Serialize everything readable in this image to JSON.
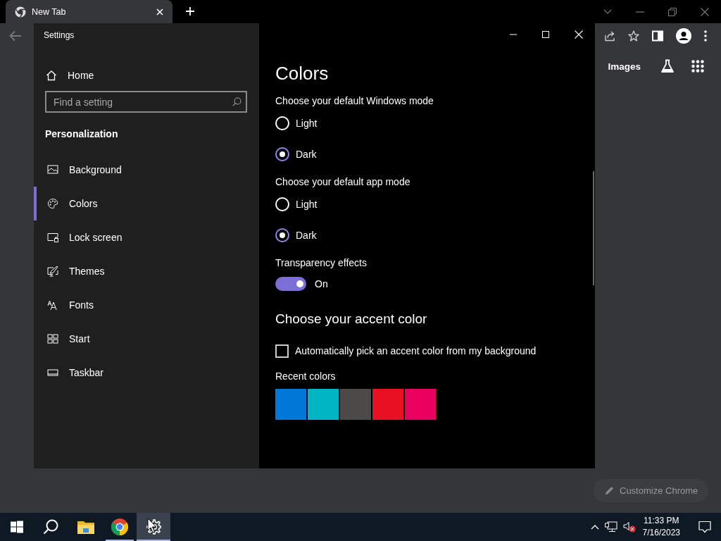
{
  "browser": {
    "tab": {
      "title": "New Tab"
    },
    "links": [
      "Images"
    ],
    "customize_button": "Customize Chrome"
  },
  "settings_window": {
    "title": "Settings",
    "home": "Home",
    "search": {
      "placeholder": "Find a setting"
    },
    "section": "Personalization",
    "nav": [
      {
        "label": "Background",
        "kind": "background",
        "selected": false
      },
      {
        "label": "Colors",
        "kind": "colors",
        "selected": true
      },
      {
        "label": "Lock screen",
        "kind": "lock",
        "selected": false
      },
      {
        "label": "Themes",
        "kind": "themes",
        "selected": false
      },
      {
        "label": "Fonts",
        "kind": "fonts",
        "selected": false
      },
      {
        "label": "Start",
        "kind": "start",
        "selected": false
      },
      {
        "label": "Taskbar",
        "kind": "taskbar",
        "selected": false
      }
    ],
    "page_title": "Colors",
    "groups": [
      {
        "label": "Choose your default Windows mode",
        "options": [
          {
            "label": "Light",
            "selected": false
          },
          {
            "label": "Dark",
            "selected": true
          }
        ]
      },
      {
        "label": "Choose your default app mode",
        "options": [
          {
            "label": "Light",
            "selected": false
          },
          {
            "label": "Dark",
            "selected": true
          }
        ]
      }
    ],
    "transparency": {
      "label": "Transparency effects",
      "on": true,
      "state_text": "On"
    },
    "accent_heading": "Choose your accent color",
    "auto_accent": {
      "label": "Automatically pick an accent color from my background",
      "checked": false
    },
    "recent_label": "Recent colors",
    "recent_colors": [
      {
        "color": "#0078d7"
      },
      {
        "color": "#00b7c3"
      },
      {
        "color": "#4c4a48"
      },
      {
        "color": "#e81123"
      },
      {
        "color": "#ea005e"
      }
    ]
  },
  "taskbar": {
    "apps": [
      {
        "kind": "start",
        "running": false,
        "selected": false
      },
      {
        "kind": "search",
        "running": false,
        "selected": false
      },
      {
        "kind": "files",
        "running": false,
        "selected": false
      },
      {
        "kind": "browser",
        "running": true,
        "selected": false
      },
      {
        "kind": "settings",
        "running": true,
        "selected": true
      }
    ],
    "time": "11:33 PM",
    "date": "7/16/2023"
  }
}
